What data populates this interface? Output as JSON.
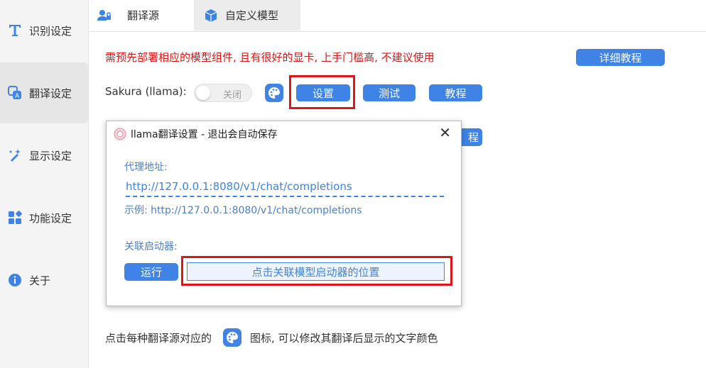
{
  "sidebar": {
    "items": [
      {
        "label": "识别设定",
        "icon": "text-t-icon"
      },
      {
        "label": "翻译设定",
        "icon": "translate-icon"
      },
      {
        "label": "显示设定",
        "icon": "magic-wand-icon"
      },
      {
        "label": "功能设定",
        "icon": "apps-grid-icon"
      },
      {
        "label": "关于",
        "icon": "info-icon"
      }
    ]
  },
  "tabs": [
    {
      "label": "翻译源",
      "icon": "user-lock-icon"
    },
    {
      "label": "自定义模型",
      "icon": "cube-icon"
    }
  ],
  "main": {
    "warning": "需预先部署相应的模型组件, 且有很好的显卡, 上手门槛高, 不建议使用",
    "detail_tutorial": "详细教程",
    "sakura_label": "Sakura (llama):",
    "toggle_text": "关闭",
    "settings_btn": "设置",
    "test_btn": "测试",
    "tutorial_btn": "教程",
    "peek_btn_text": "程",
    "bottom_note_before": "点击每种翻译源对应的",
    "bottom_note_after": "图标, 可以修改其翻译后显示的文字颜色"
  },
  "dialog": {
    "title": "llama翻译设置 - 退出会自动保存",
    "proxy_label": "代理地址:",
    "proxy_value": "http://127.0.0.1:8080/v1/chat/completions",
    "example": "示例: http://127.0.0.1:8080/v1/chat/completions",
    "launcher_label": "关联启动器:",
    "run_btn": "运行",
    "launcher_path_btn": "点击关联模型启动器的位置",
    "close_glyph": "✕"
  },
  "colors": {
    "accent": "#3f83e6",
    "warning": "#e01515",
    "highlight_box": "#e0141b"
  }
}
